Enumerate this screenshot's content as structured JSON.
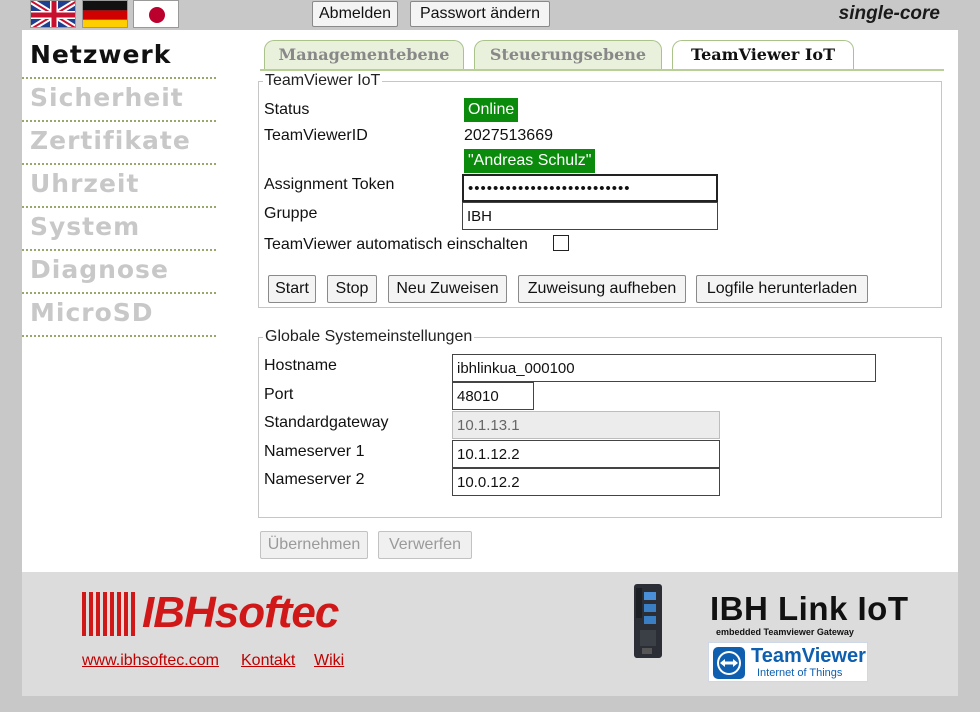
{
  "topbar": {
    "flags": [
      "uk-flag-icon",
      "german-flag-icon",
      "japan-flag-icon"
    ],
    "logout_label": "Abmelden",
    "change_password_label": "Passwort ändern",
    "mode": "single-core"
  },
  "nav": {
    "items": [
      {
        "label": "Netzwerk",
        "active": true
      },
      {
        "label": "Sicherheit",
        "active": false
      },
      {
        "label": "Zertifikate",
        "active": false
      },
      {
        "label": "Uhrzeit",
        "active": false
      },
      {
        "label": "System",
        "active": false
      },
      {
        "label": "Diagnose",
        "active": false
      },
      {
        "label": "MicroSD",
        "active": false
      }
    ]
  },
  "tabs": [
    {
      "label": "Managementebene",
      "active": false
    },
    {
      "label": "Steuerungsebene",
      "active": false
    },
    {
      "label": "TeamViewer IoT",
      "active": true
    }
  ],
  "teamviewer": {
    "legend": "TeamViewer IoT",
    "status_label": "Status",
    "status_value": "Online",
    "id_label": "TeamViewerID",
    "id_value": "2027513669",
    "account_value": "\"Andreas Schulz\"",
    "token_label": "Assignment Token",
    "token_value": "••••••••••••••••••••••••••",
    "group_label": "Gruppe",
    "group_value": "IBH",
    "autostart_label": "TeamViewer automatisch einschalten",
    "autostart_checked": false,
    "buttons": {
      "start": "Start",
      "stop": "Stop",
      "reassign": "Neu Zuweisen",
      "unassign": "Zuweisung aufheben",
      "logfile": "Logfile herunterladen"
    }
  },
  "global": {
    "legend": "Globale Systemeinstellungen",
    "hostname_label": "Hostname",
    "hostname_value": "ibhlinkua_000100",
    "port_label": "Port",
    "port_value": "48010",
    "gateway_label": "Standardgateway",
    "gateway_value": "10.1.13.1",
    "ns1_label": "Nameserver 1",
    "ns1_value": "10.1.12.2",
    "ns2_label": "Nameserver 2",
    "ns2_value": "10.0.12.2"
  },
  "actions": {
    "apply": "Übernehmen",
    "discard": "Verwerfen"
  },
  "footer": {
    "company_logo": "IBHsoftec",
    "links": {
      "site": "www.ibhsoftec.com",
      "contact": "Kontakt",
      "wiki": "Wiki"
    },
    "product_name": "IBH Link IoT",
    "product_sub": "embedded Teamviewer Gateway",
    "partner_name": "TeamViewer",
    "partner_sub": "Internet of Things"
  },
  "colors": {
    "online": "#0b8b0b",
    "brand_red": "#d01818",
    "teamviewer_blue": "#0e5fb0",
    "tab_green": "#e9f1dc"
  }
}
